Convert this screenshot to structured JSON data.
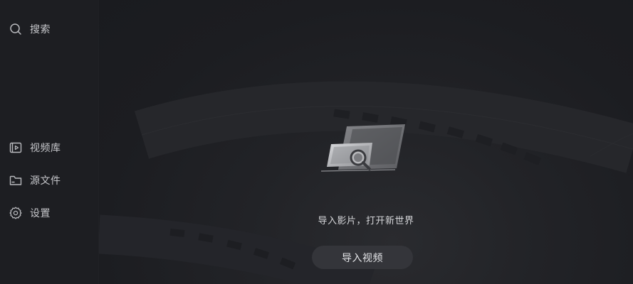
{
  "sidebar": {
    "search": {
      "label": "搜索",
      "icon": "search-icon"
    },
    "items": [
      {
        "label": "视频库",
        "icon": "video-library-icon"
      },
      {
        "label": "源文件",
        "icon": "folder-icon"
      },
      {
        "label": "设置",
        "icon": "gear-icon"
      }
    ]
  },
  "main": {
    "illustration_icon": "import-media-illustration",
    "tagline": "导入影片，打开新世界",
    "import_button_label": "导入视频"
  },
  "colors": {
    "background": "#1b1c20",
    "sidebar": "#1d1e22",
    "button": "#34353a",
    "text": "#c9cace"
  }
}
